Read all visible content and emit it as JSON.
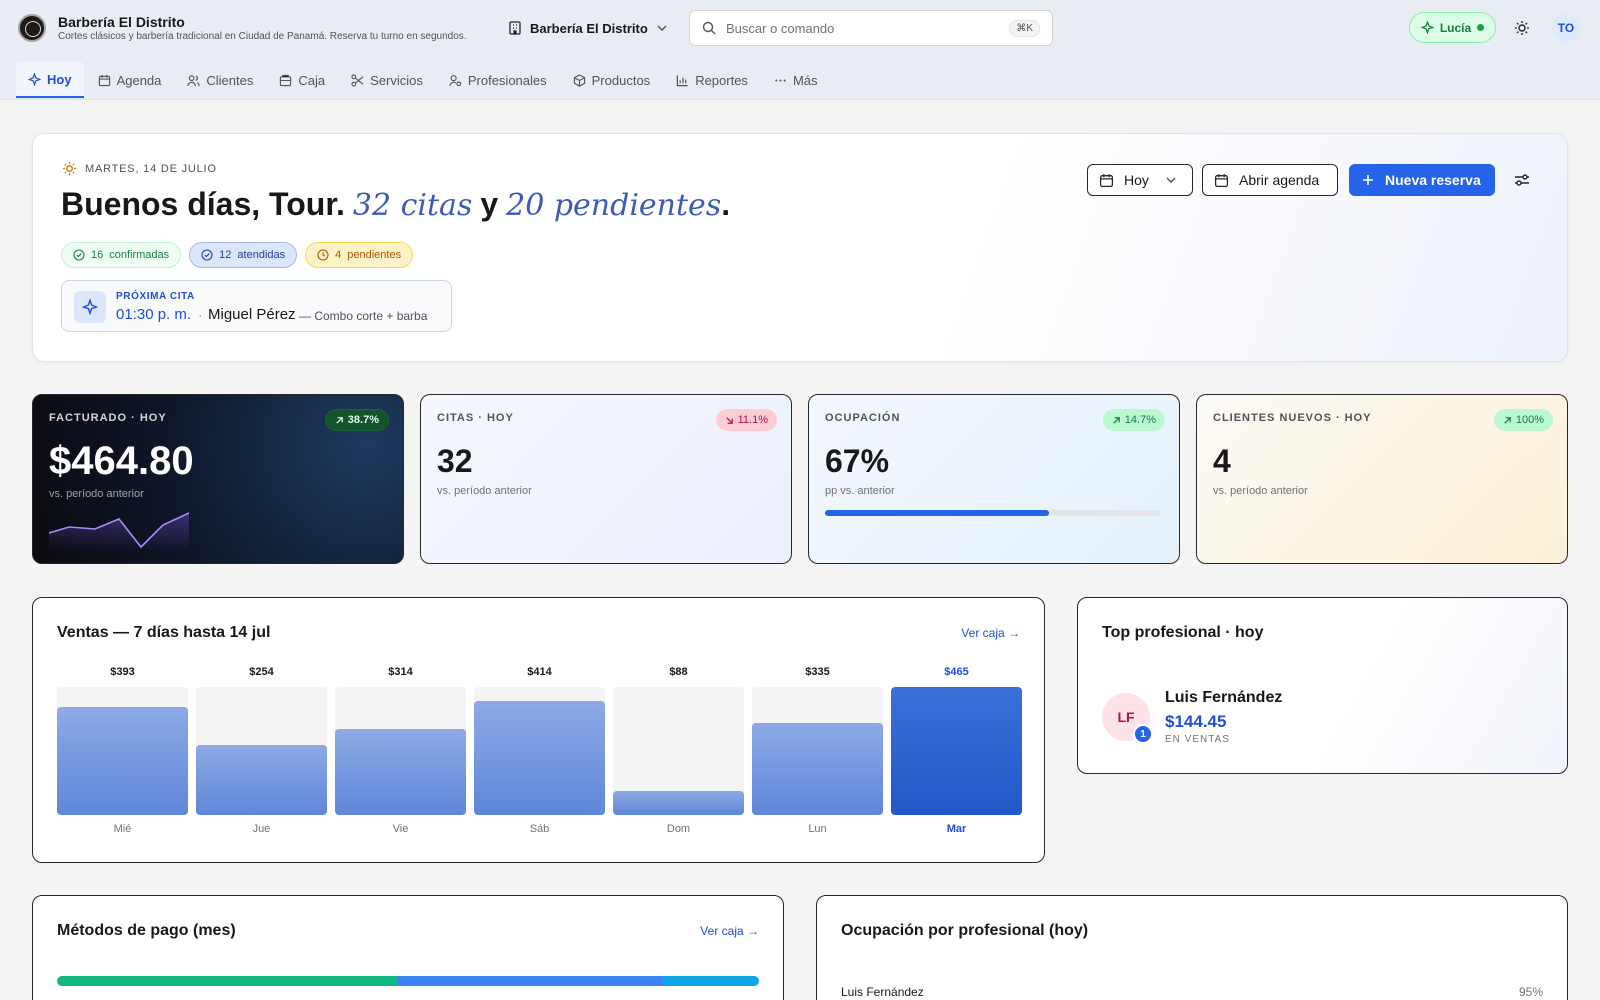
{
  "app": {
    "name": "Barbería El Distrito",
    "subtitle": "Cortes clásicos y barbería tradicional en Ciudad de Panamá. Reserva tu turno en segundos.",
    "location": "Barbería El Distrito",
    "search_placeholder": "Buscar o comando",
    "search_shortcut": "⌘K",
    "assistant_label": "Lucía",
    "user_initials": "TO"
  },
  "nav": [
    {
      "label": "Hoy",
      "icon": "sparkle-icon",
      "active": true
    },
    {
      "label": "Agenda",
      "icon": "calendar-icon"
    },
    {
      "label": "Clientes",
      "icon": "users-icon"
    },
    {
      "label": "Caja",
      "icon": "register-icon"
    },
    {
      "label": "Servicios",
      "icon": "scissors-icon"
    },
    {
      "label": "Profesionales",
      "icon": "professional-icon"
    },
    {
      "label": "Productos",
      "icon": "box-icon"
    },
    {
      "label": "Reportes",
      "icon": "bar-chart-icon"
    },
    {
      "label": "Más",
      "icon": "more-icon"
    }
  ],
  "hero": {
    "date": "MARTES, 14 DE JULIO",
    "greeting": "Buenos días, Tour.",
    "citas": "32 citas",
    "connector": "y",
    "pendientes": "20 pendientes",
    "period": ".",
    "pills": {
      "confirmed_count": "16",
      "confirmed_label": "confirmadas",
      "attended_count": "12",
      "attended_label": "atendidas",
      "pending_count": "4",
      "pending_label": "pendientes"
    },
    "next": {
      "label": "PRÓXIMA CITA",
      "time": "01:30 p. m.",
      "separator": "·",
      "client": "Miguel Pérez",
      "service": "— Combo corte + barba"
    },
    "buttons": {
      "period": "Hoy",
      "open_agenda": "Abrir agenda",
      "new_booking": "Nueva reserva"
    }
  },
  "kpis": {
    "revenue": {
      "label": "FACTURADO · HOY",
      "value": "$464.80",
      "sub": "vs. período anterior",
      "delta": "38.7%"
    },
    "appointments": {
      "label": "CITAS · HOY",
      "value": "32",
      "sub": "vs. período anterior",
      "delta": "11.1%"
    },
    "occupancy": {
      "label": "OCUPACIÓN",
      "value": "67%",
      "sub": "pp vs. anterior",
      "delta": "14.7%",
      "progress": 0.67
    },
    "new_clients": {
      "label": "CLIENTES NUEVOS · HOY",
      "value": "4",
      "sub": "vs. período anterior",
      "delta": "100%"
    }
  },
  "sales": {
    "title": "Ventas — 7 días hasta 14 jul",
    "link": "Ver caja →"
  },
  "chart_data": {
    "type": "bar",
    "categories": [
      "Mié",
      "Jue",
      "Vie",
      "Sáb",
      "Dom",
      "Lun",
      "Mar"
    ],
    "values": [
      393,
      254,
      314,
      414,
      88,
      335,
      465
    ],
    "labels": [
      "$393",
      "$254",
      "$314",
      "$414",
      "$88",
      "$335",
      "$465"
    ],
    "highlight_index": 6,
    "ylim": [
      0,
      465
    ]
  },
  "top_pro": {
    "title": "Top profesional · hoy",
    "initials": "LF",
    "rank": "1",
    "name": "Luis Fernández",
    "amount": "$144.45",
    "amount_label": "EN VENTAS"
  },
  "payments": {
    "title": "Métodos de pago (mes)",
    "link": "Ver caja →",
    "segments": [
      {
        "share": 0.485,
        "color": "#10b981"
      },
      {
        "share": 0.378,
        "color": "#3b82f6"
      },
      {
        "share": 0.137,
        "color": "#0ea5e9"
      }
    ]
  },
  "occupancy_by_pro": {
    "title": "Ocupación por profesional (hoy)",
    "rows": [
      {
        "name": "Luis Fernández",
        "pct": "95%"
      }
    ]
  },
  "colors": {
    "accent": "#2563eb",
    "success": "#16a34a",
    "danger": "#be123c",
    "warning": "#b45309"
  }
}
